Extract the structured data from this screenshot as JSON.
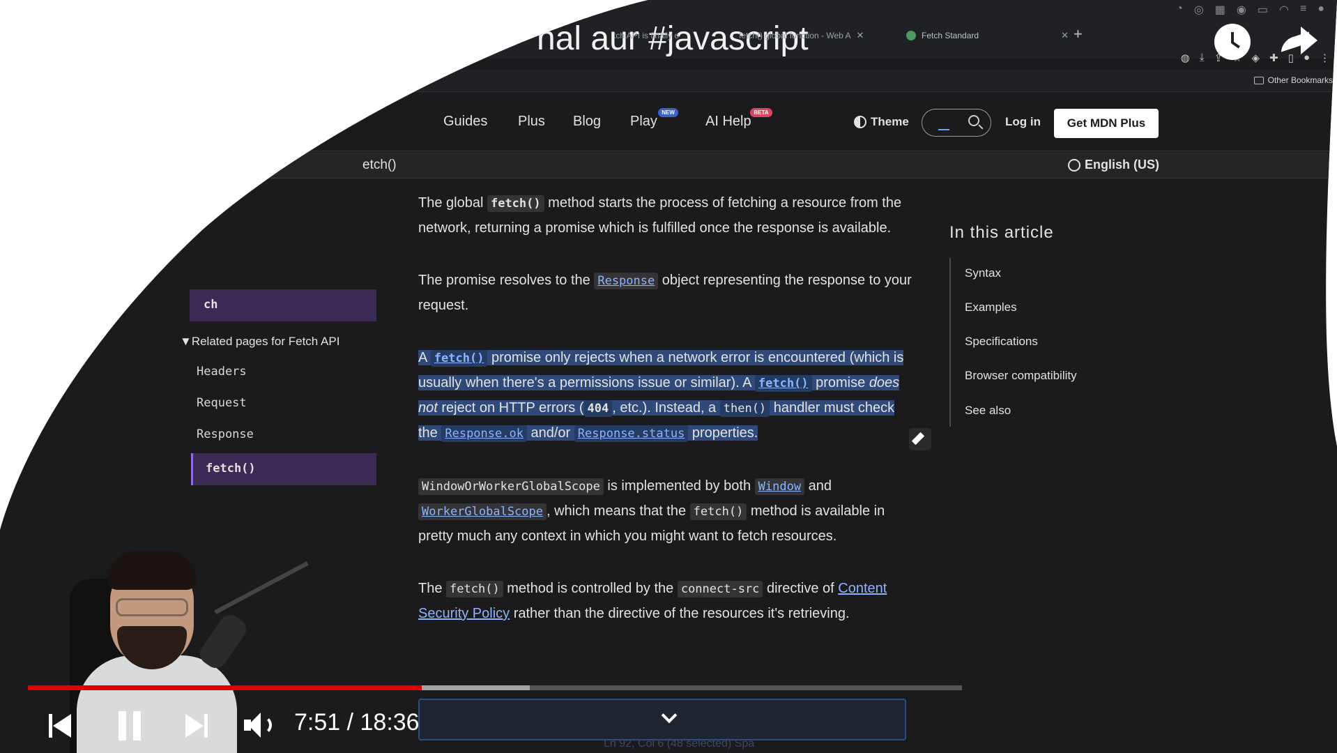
{
  "video": {
    "title": "nal aur #javascript",
    "time_display": "7:51 / 18:36",
    "progress_played": 0.4217,
    "progress_buffered": 0.5373
  },
  "browser": {
    "tabs": [
      {
        "label": "tch API is finally o"
      },
      {
        "label": "fetch() global function - Web A"
      },
      {
        "label": "Fetch Standard"
      }
    ],
    "new_tab": "+",
    "other_bookmarks": "Other Bookmarks"
  },
  "nav": {
    "guides": "Guides",
    "plus": "Plus",
    "blog": "Blog",
    "play": "Play",
    "play_badge": "NEW",
    "ai_help": "AI Help",
    "ai_badge": "BETA",
    "theme": "Theme",
    "login": "Log in",
    "get_plus": "Get MDN Plus"
  },
  "breadcrumb": {
    "current": "etch()",
    "language": "English (US)"
  },
  "sidebar": {
    "active_top": "ch",
    "related_toggle": "▼Related pages for Fetch API",
    "items": [
      "Headers",
      "Request",
      "Response"
    ],
    "current": "fetch()"
  },
  "article": {
    "p1": {
      "a": "The global ",
      "code": "fetch()",
      "b": " method starts the process of fetching a resource from the network, returning a promise which is fulfilled once the response is available."
    },
    "p2": {
      "a": "The promise resolves to the ",
      "link": "Response",
      "b": " object representing the response to your request."
    },
    "p3": {
      "a": "A ",
      "code1": "fetch()",
      "b": " promise only rejects when a network error is encountered (which is usually when there's a permissions issue or similar). A ",
      "code2": "fetch()",
      "c": " promise ",
      "em": "does not",
      "d": " reject on HTTP errors (",
      "code3": "404",
      "e": ", etc.). Instead, a ",
      "code4": "then()",
      "f": " handler must check the ",
      "link1": "Response.ok",
      "g": " and/or ",
      "link2": "Response.status",
      "h": " properties."
    },
    "p4": {
      "code1": "WindowOrWorkerGlobalScope",
      "a": " is implemented by both ",
      "link1": "Window",
      "b": " and ",
      "link2": "WorkerGlobalScope",
      "c": ", which means that the ",
      "code2": "fetch()",
      "d": " method is available in pretty much any context in which you might want to fetch resources."
    },
    "p5": {
      "a": "The ",
      "code1": "fetch()",
      "b": " method is controlled by the ",
      "code2": "connect-src",
      "c": " directive of ",
      "link": "Content Security Policy",
      "d": " rather than the directive of the resources it's retrieving."
    }
  },
  "toc": {
    "title": "In this article",
    "items": [
      "Syntax",
      "Examples",
      "Specifications",
      "Browser compatibility",
      "See also"
    ]
  },
  "editor_status": "Ln 92, Col 6 (48 selected)   Spa",
  "colors": {
    "accent": "#e00000",
    "link": "#8cb4ff",
    "selection": "#2f4a7a",
    "sidebar_active": "#3a2a55"
  }
}
